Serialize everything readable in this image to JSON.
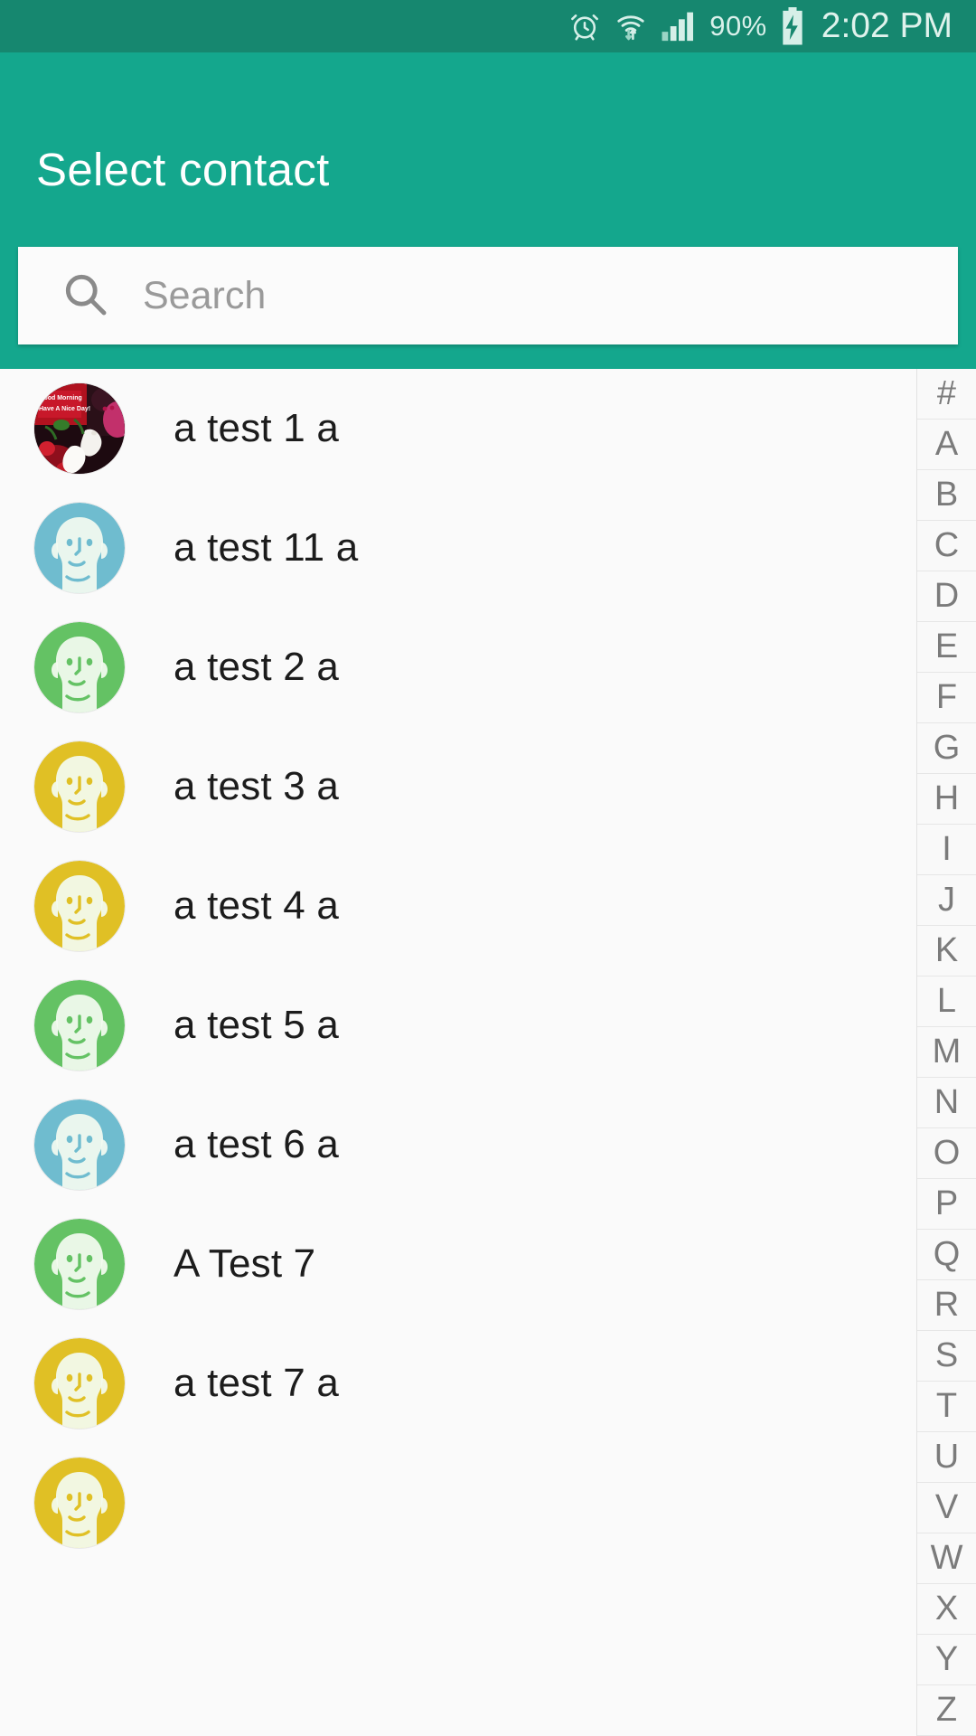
{
  "status_bar": {
    "alarm_icon": "alarm-clock-icon",
    "wifi_icon": "wifi-transfer-icon",
    "signal_icon": "cellular-signal-icon",
    "battery_percent": "90%",
    "battery_icon": "battery-charging-icon",
    "time": "2:02 PM"
  },
  "app_bar": {
    "title": "Select contact",
    "background_color": "#14a78d",
    "status_bar_color": "#16876f"
  },
  "search": {
    "icon": "search-icon",
    "placeholder": "Search",
    "value": ""
  },
  "contacts": [
    {
      "name": "a test 1 a",
      "avatar_type": "photo",
      "avatar_color": "#c01a2a"
    },
    {
      "name": "a test 11 a",
      "avatar_type": "default",
      "avatar_color": "#6fbccf"
    },
    {
      "name": "a test 2 a",
      "avatar_type": "default",
      "avatar_color": "#64c264"
    },
    {
      "name": "a test 3 a",
      "avatar_type": "default",
      "avatar_color": "#e0c025"
    },
    {
      "name": "a test 4 a",
      "avatar_type": "default",
      "avatar_color": "#e0c025"
    },
    {
      "name": "a test 5 a",
      "avatar_type": "default",
      "avatar_color": "#64c264"
    },
    {
      "name": "a test 6 a",
      "avatar_type": "default",
      "avatar_color": "#6fbccf"
    },
    {
      "name": "A Test 7",
      "avatar_type": "default",
      "avatar_color": "#64c264"
    },
    {
      "name": "a test 7 a",
      "avatar_type": "default",
      "avatar_color": "#e0c025"
    },
    {
      "name": "",
      "avatar_type": "default",
      "avatar_color": "#e0c025"
    }
  ],
  "alpha_index": [
    "#",
    "A",
    "B",
    "C",
    "D",
    "E",
    "F",
    "G",
    "H",
    "I",
    "J",
    "K",
    "L",
    "M",
    "N",
    "O",
    "P",
    "Q",
    "R",
    "S",
    "T",
    "U",
    "V",
    "W",
    "X",
    "Y",
    "Z"
  ]
}
